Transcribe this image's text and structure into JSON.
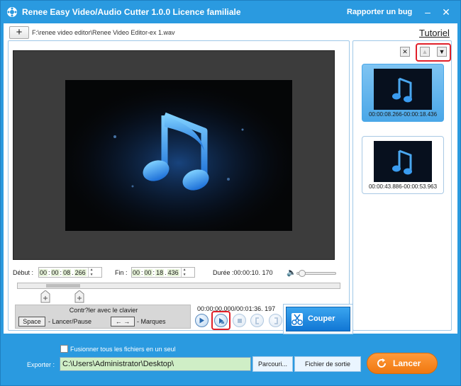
{
  "window": {
    "title": "Renee Easy Video/Audio Cutter 1.0.0 Licence familiale",
    "bug_link": "Rapporter un bug",
    "minimize": "–",
    "close": "✕"
  },
  "toolbar": {
    "add_label": "+",
    "file_path": "F:\\renee video editor\\Renee Video Editor-ex 1.wav",
    "tutorial": "Tutoriel"
  },
  "times": {
    "start_label": "Début :",
    "start": {
      "h": "00",
      "m": "00",
      "s": "08",
      "ms": "266"
    },
    "end_label": "Fin :",
    "end": {
      "h": "00",
      "m": "00",
      "s": "18",
      "ms": "436"
    },
    "duration": "Durée :00:00:10. 170",
    "playback": "00:00:00.000/00:01:36. 197"
  },
  "keyboard": {
    "title": "Contr?ler avec le clavier",
    "space_key": "Space",
    "space_action": "- Lancer/Pause",
    "arrows_key": "← →",
    "arrows_action": "- Marques"
  },
  "actions": {
    "cut": "Couper",
    "launch": "Lancer"
  },
  "clips": [
    {
      "label": "00:00:08.266-00:00:18.436",
      "selected": true
    },
    {
      "label": "00:00:43.886-00:00:53.963",
      "selected": false
    }
  ],
  "clip_panel": {
    "delete": "✕",
    "up": "▲",
    "down": "▼"
  },
  "bottom": {
    "merge_label": "Fusionner tous les fichiers en un seul",
    "export_label": "Exporter :",
    "export_path": "C:\\Users\\Administrator\\Desktop\\",
    "browse": "Parcouri...",
    "output_folder": "Fichier de sortie"
  },
  "colors": {
    "window_blue": "#2a9ae0",
    "launch_orange": "#f07810",
    "highlight_red": "#e0202a"
  }
}
